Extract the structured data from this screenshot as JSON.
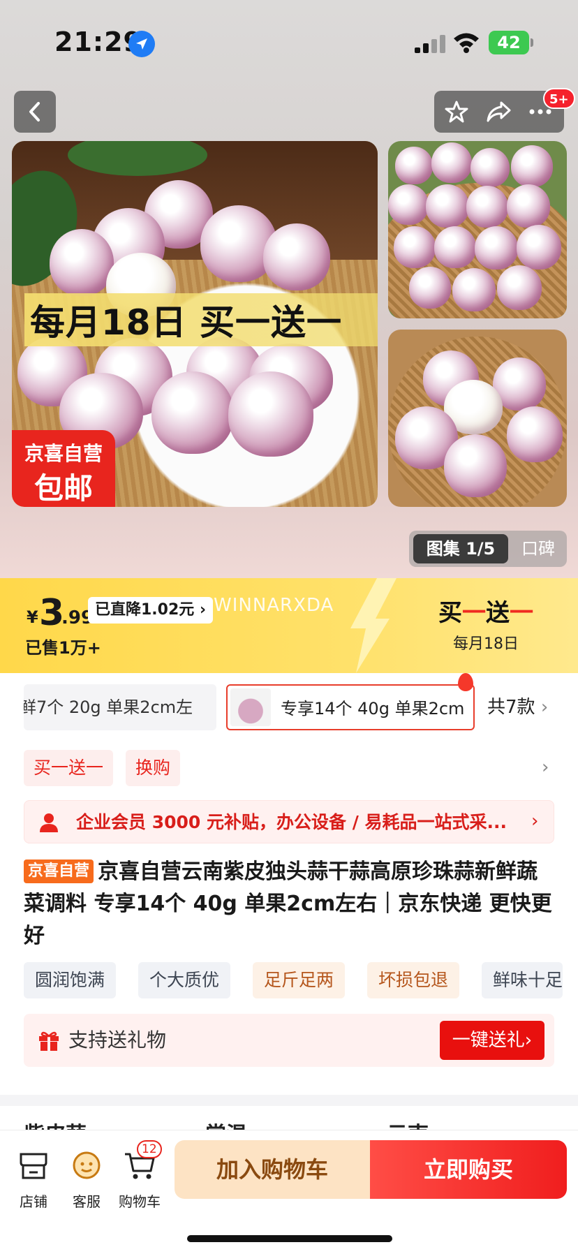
{
  "status": {
    "time": "21:29",
    "battery": "42"
  },
  "header": {
    "more_badge": "5+"
  },
  "gallery": {
    "promo_text": "每月18日 买一送一",
    "corner_line1": "京喜自营",
    "corner_line2": "包邮",
    "switch_active": "图集 1/5",
    "switch_inactive": "口碑"
  },
  "price": {
    "currency": "¥",
    "integer": "3",
    "decimal": ".99",
    "drop_label": "已直降1.02元",
    "watermark": "WINNARXDA",
    "sold": "已售1万+",
    "bogo_part1": "买",
    "bogo_part2": "一",
    "bogo_part3": "送",
    "bogo_part4": "一",
    "bogo_sub": "每月18日"
  },
  "variants": {
    "items": [
      "鲜7个 20g 单果2cm左",
      "专享14个 40g 单果2cm"
    ],
    "count_label": "共7款"
  },
  "promo_tags": [
    "买一送一",
    "换购"
  ],
  "member": {
    "text": "企业会员 3000 元补贴，办公设备 / 易耗品一站式采..."
  },
  "product": {
    "badge": "京喜自营",
    "title": "京喜自营云南紫皮独头蒜干蒜高原珍珠蒜新鲜蔬菜调料 专享14个 40g 单果2cm左右｜京东快递 更快更好"
  },
  "features": [
    "圆润饱满",
    "个大质优",
    "足斤足两",
    "坏损包退",
    "鲜味十足"
  ],
  "gift": {
    "text": "支持送礼物",
    "button": "一键送礼"
  },
  "peek": [
    "紫皮蒜",
    "常温",
    "云南"
  ],
  "bottom": {
    "store": "店铺",
    "service": "客服",
    "cart": "购物车",
    "cart_count": "12",
    "add_cart": "加入购物车",
    "buy_now": "立即购买"
  },
  "colors": {
    "accent_red": "#e8251e",
    "price_yellow": "#ffd84a",
    "self_orange": "#f76b1c"
  }
}
